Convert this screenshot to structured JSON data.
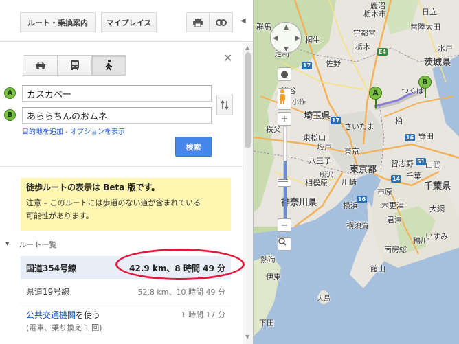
{
  "toolbar": {
    "route_label": "ルート・乗換案内",
    "myplaces_label": "マイプレイス",
    "print_icon": "printer-icon",
    "link_icon": "link-icon"
  },
  "modes": [
    {
      "name": "car",
      "icon": "car-icon"
    },
    {
      "name": "transit",
      "icon": "bus-icon"
    },
    {
      "name": "walking",
      "icon": "walking-icon",
      "selected": true
    }
  ],
  "waypoints": [
    {
      "marker": "A",
      "value": "カスカベー"
    },
    {
      "marker": "B",
      "value": "あららちんのおムネ"
    }
  ],
  "links": {
    "add_destination": "目的地を追加",
    "separator": " - ",
    "show_options": "オプションを表示"
  },
  "search_label": "検索",
  "beta": {
    "title": "徒歩ルートの表示は Beta 版です。",
    "line1": "注意 – このルートには歩道のない道が含まれている",
    "line2": "可能性があります。"
  },
  "route_list_label": "ルート一覧",
  "routes": [
    {
      "name": "国道354号線",
      "summary": "42.9 km、8 時間 49 分",
      "selected": true
    },
    {
      "name": "県道19号線",
      "summary": "52.8 km、10 時間 49 分"
    }
  ],
  "transit": {
    "link_prefix": "公共交通機関",
    "link_suffix": "を使う",
    "time": "1 時間 17 分",
    "sub": "(電車、乗り換え 1 回)"
  },
  "map": {
    "labels": {
      "gunma": "群馬",
      "tochigi_city": "栃木市",
      "kanuma": "鹿沼",
      "utsunomiya_top": "宇都宮",
      "hitachi": "日立",
      "hitachiota": "常陸太田",
      "kiryu": "桐生",
      "ashikaga": "足利",
      "mito": "水戸",
      "sano": "佐野",
      "tochigi": "栃木",
      "ibaraki": "茨城県",
      "tsukuba": "つくば",
      "saitama_pref": "埼玉県",
      "kumagaya": "熊谷",
      "chichibu": "秩父",
      "higashimatsuyama": "東松山",
      "saitama": "さいたま",
      "tokyo_to": "東京都",
      "tokyo": "東京",
      "hachioji": "八王子",
      "sagamihara": "相模原",
      "kawasaki": "川崎",
      "yokohama": "横浜",
      "yokosuka": "横須賀",
      "kanagawa": "神奈川県",
      "chiba_pref": "千葉県",
      "chiba": "千葉",
      "narashino": "習志野",
      "ichihara": "市原",
      "kisarazu": "木更津",
      "kimitsu": "君津",
      "kamogawa": "鴨川",
      "minamiboso": "南房総",
      "tateyama": "館山",
      "ito": "伊東",
      "shimoda": "下田",
      "oshima": "大島",
      "isumi": "いすみ",
      "atami": "熱海",
      "kajigaya": "小作",
      "sakado": "坂戸",
      "tokorozawa": "所沢",
      "kashiwa": "柏",
      "noda": "野田",
      "yamato": "山武",
      "oami": "大網"
    },
    "pins": [
      "A",
      "B"
    ],
    "route_color": "#8a7dd8"
  }
}
